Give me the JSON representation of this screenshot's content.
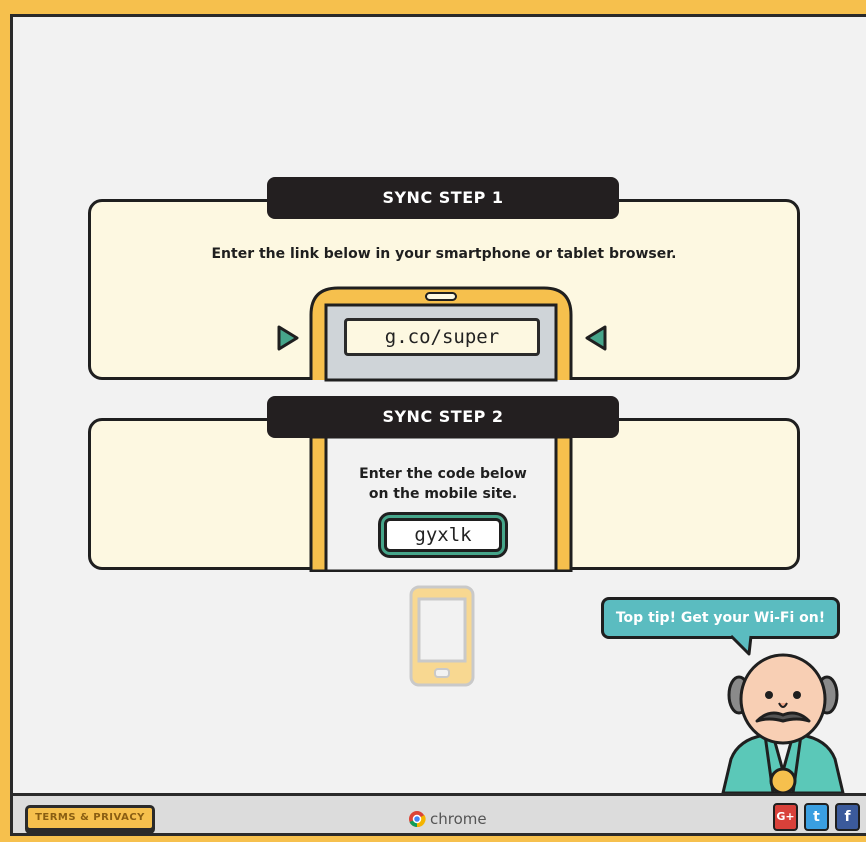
{
  "step1": {
    "banner": "SYNC STEP 1",
    "instruction": "Enter the link below in your smartphone or tablet browser.",
    "link": "g.co/super"
  },
  "step2": {
    "banner": "SYNC STEP 2",
    "instruction_line1": "Enter the code below",
    "instruction_line2": "on the mobile site.",
    "code": "gyxlk"
  },
  "tip": {
    "text": "Top tip! Get your Wi-Fi on!"
  },
  "footer": {
    "terms_label": "TERMS & PRIVACY",
    "brand": "chrome",
    "social": [
      {
        "name": "google-plus",
        "label": "G+",
        "color": "#d8413a"
      },
      {
        "name": "twitter",
        "label": "t",
        "color": "#3a9fe1"
      },
      {
        "name": "facebook",
        "label": "f",
        "color": "#3b5a9b"
      }
    ]
  },
  "colors": {
    "frame": "#f6c04d",
    "background": "#f2f2f2",
    "panel": "#fdf8e1",
    "banner": "#231f20",
    "phone": "#f6c04d",
    "accent": "#46a58a",
    "bubble": "#5bbcc0"
  }
}
